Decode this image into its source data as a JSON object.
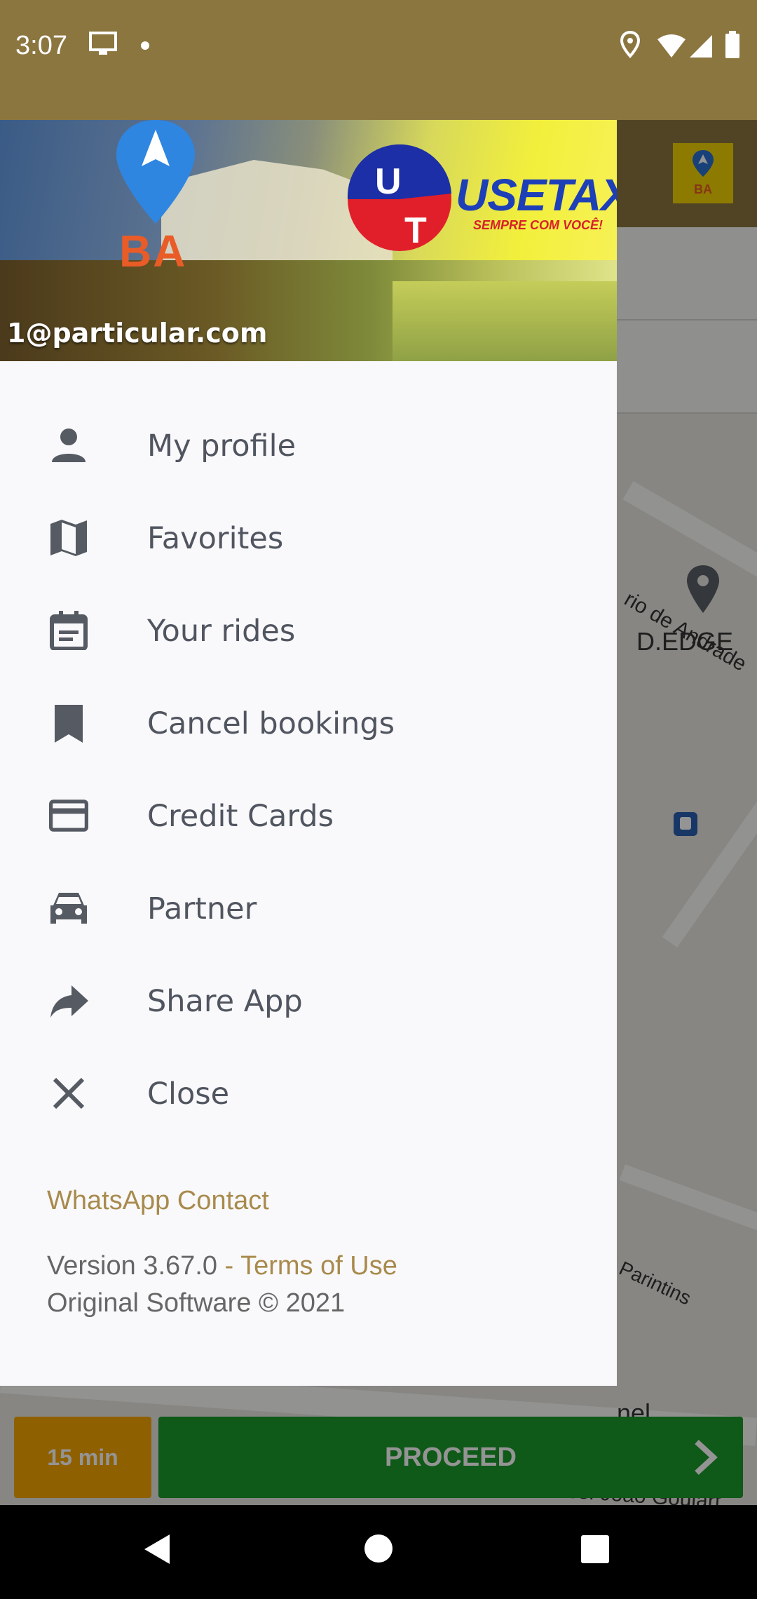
{
  "status_bar": {
    "time": "3:07",
    "icons": [
      "screen-cast-icon",
      "notification-dot-icon",
      "location-icon",
      "wifi-icon",
      "cell-signal-icon",
      "battery-icon"
    ]
  },
  "header": {
    "brand_region": "BA",
    "brand_name": "USETAXI",
    "brand_tagline": "SEMPRE COM VOCÊ!",
    "logo_letters": [
      "U",
      "T"
    ],
    "user_email": "1@particular.com"
  },
  "menu": {
    "items": [
      {
        "label": "My profile",
        "icon": "person-icon"
      },
      {
        "label": "Favorites",
        "icon": "map-icon"
      },
      {
        "label": "Your rides",
        "icon": "calendar-icon"
      },
      {
        "label": "Cancel bookings",
        "icon": "bookmark-icon"
      },
      {
        "label": "Credit Cards",
        "icon": "credit-card-icon"
      },
      {
        "label": "Partner",
        "icon": "car-icon"
      },
      {
        "label": "Share App",
        "icon": "share-icon"
      },
      {
        "label": "Close",
        "icon": "close-icon"
      }
    ]
  },
  "footer": {
    "whatsapp": "WhatsApp Contact",
    "version": "Version 3.67.0",
    "separator": " - ",
    "terms": "Terms of Use",
    "copyright": "Original Software © 2021"
  },
  "background_app": {
    "map_labels": {
      "street_1": "rio de Andrade",
      "place_1": "D.EDGE",
      "street_2": "Parintins",
      "partial_1": "nel",
      "street_3": "ado Pres. João Goulart"
    },
    "eta_label": "15 min",
    "proceed_label": "PROCEED"
  },
  "colors": {
    "status_bar": "#8c7640",
    "accent_gold": "#a88a4c",
    "menu_text": "#505560",
    "proceed_green": "#1a9a2c",
    "eta_orange": "#f6a500",
    "drawer_bg": "#f9f9fb"
  }
}
